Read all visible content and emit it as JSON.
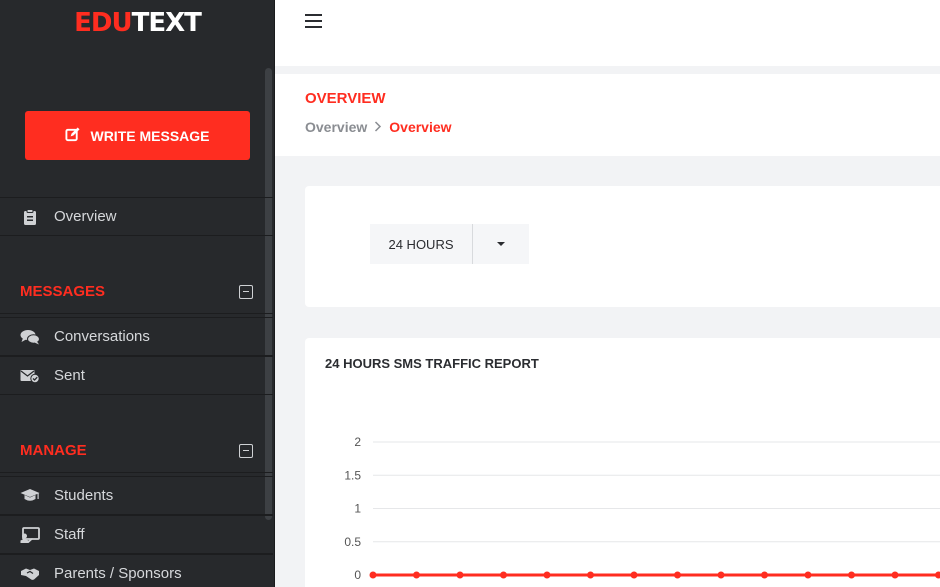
{
  "app": {
    "logo_part1": "EDU",
    "logo_part2": "TEXT",
    "brand_color": "#ff2d20"
  },
  "sidebar": {
    "write_button": "WRITE MESSAGE",
    "items": [
      {
        "label": "Overview",
        "icon": "clipboard-icon"
      }
    ],
    "sections": [
      {
        "title": "MESSAGES",
        "items": [
          {
            "label": "Conversations",
            "icon": "comments-icon"
          },
          {
            "label": "Sent",
            "icon": "envelope-check-icon"
          }
        ]
      },
      {
        "title": "MANAGE",
        "items": [
          {
            "label": "Students",
            "icon": "graduation-cap-icon"
          },
          {
            "label": "Staff",
            "icon": "chalkboard-teacher-icon"
          },
          {
            "label": "Parents / Sponsors",
            "icon": "handshake-icon"
          }
        ]
      }
    ]
  },
  "header": {
    "title": "OVERVIEW",
    "breadcrumb": [
      "Overview",
      "Overview"
    ]
  },
  "filter": {
    "selected": "24 HOURS"
  },
  "report": {
    "title": "24 HOURS SMS TRAFFIC REPORT"
  },
  "chart_data": {
    "type": "line",
    "title": "24 HOURS SMS TRAFFIC REPORT",
    "xlabel": "",
    "ylabel": "",
    "ylim": [
      0,
      2
    ],
    "y_ticks": [
      "0",
      "0.5",
      "1",
      "1.5",
      "2"
    ],
    "grid": true,
    "series": [
      {
        "color": "#ff2d20",
        "values": [
          0,
          0,
          0,
          0,
          0,
          0,
          0,
          0,
          0,
          0,
          0,
          0,
          0,
          0
        ]
      }
    ]
  }
}
